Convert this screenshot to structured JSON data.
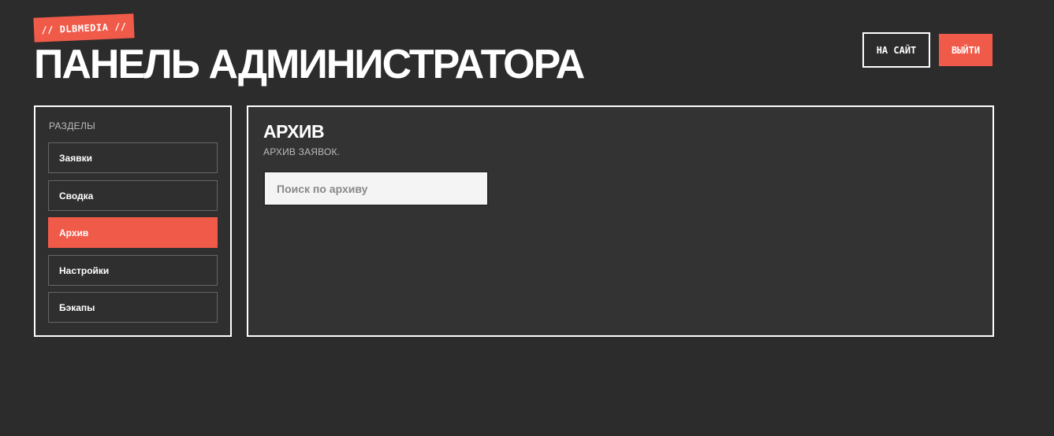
{
  "brand": {
    "tag": "// DLBMEDIA //"
  },
  "header": {
    "title": "ПАНЕЛЬ АДМИНИСТРАТОРА",
    "site_button": "НА САЙТ",
    "logout_button": "ВЫЙТИ"
  },
  "sidebar": {
    "heading": "РАЗДЕЛЫ",
    "items": [
      {
        "label": "Заявки",
        "active": false
      },
      {
        "label": "Сводка",
        "active": false
      },
      {
        "label": "Архив",
        "active": true
      },
      {
        "label": "Настройки",
        "active": false
      },
      {
        "label": "Бэкапы",
        "active": false
      }
    ]
  },
  "main": {
    "title": "АРХИВ",
    "description": "АРХИВ ЗАЯВОК.",
    "search": {
      "placeholder": "Поиск по архиву",
      "value": ""
    }
  },
  "colors": {
    "background": "#2c2c2c",
    "accent": "#f05a49",
    "border": "#ffffff"
  }
}
